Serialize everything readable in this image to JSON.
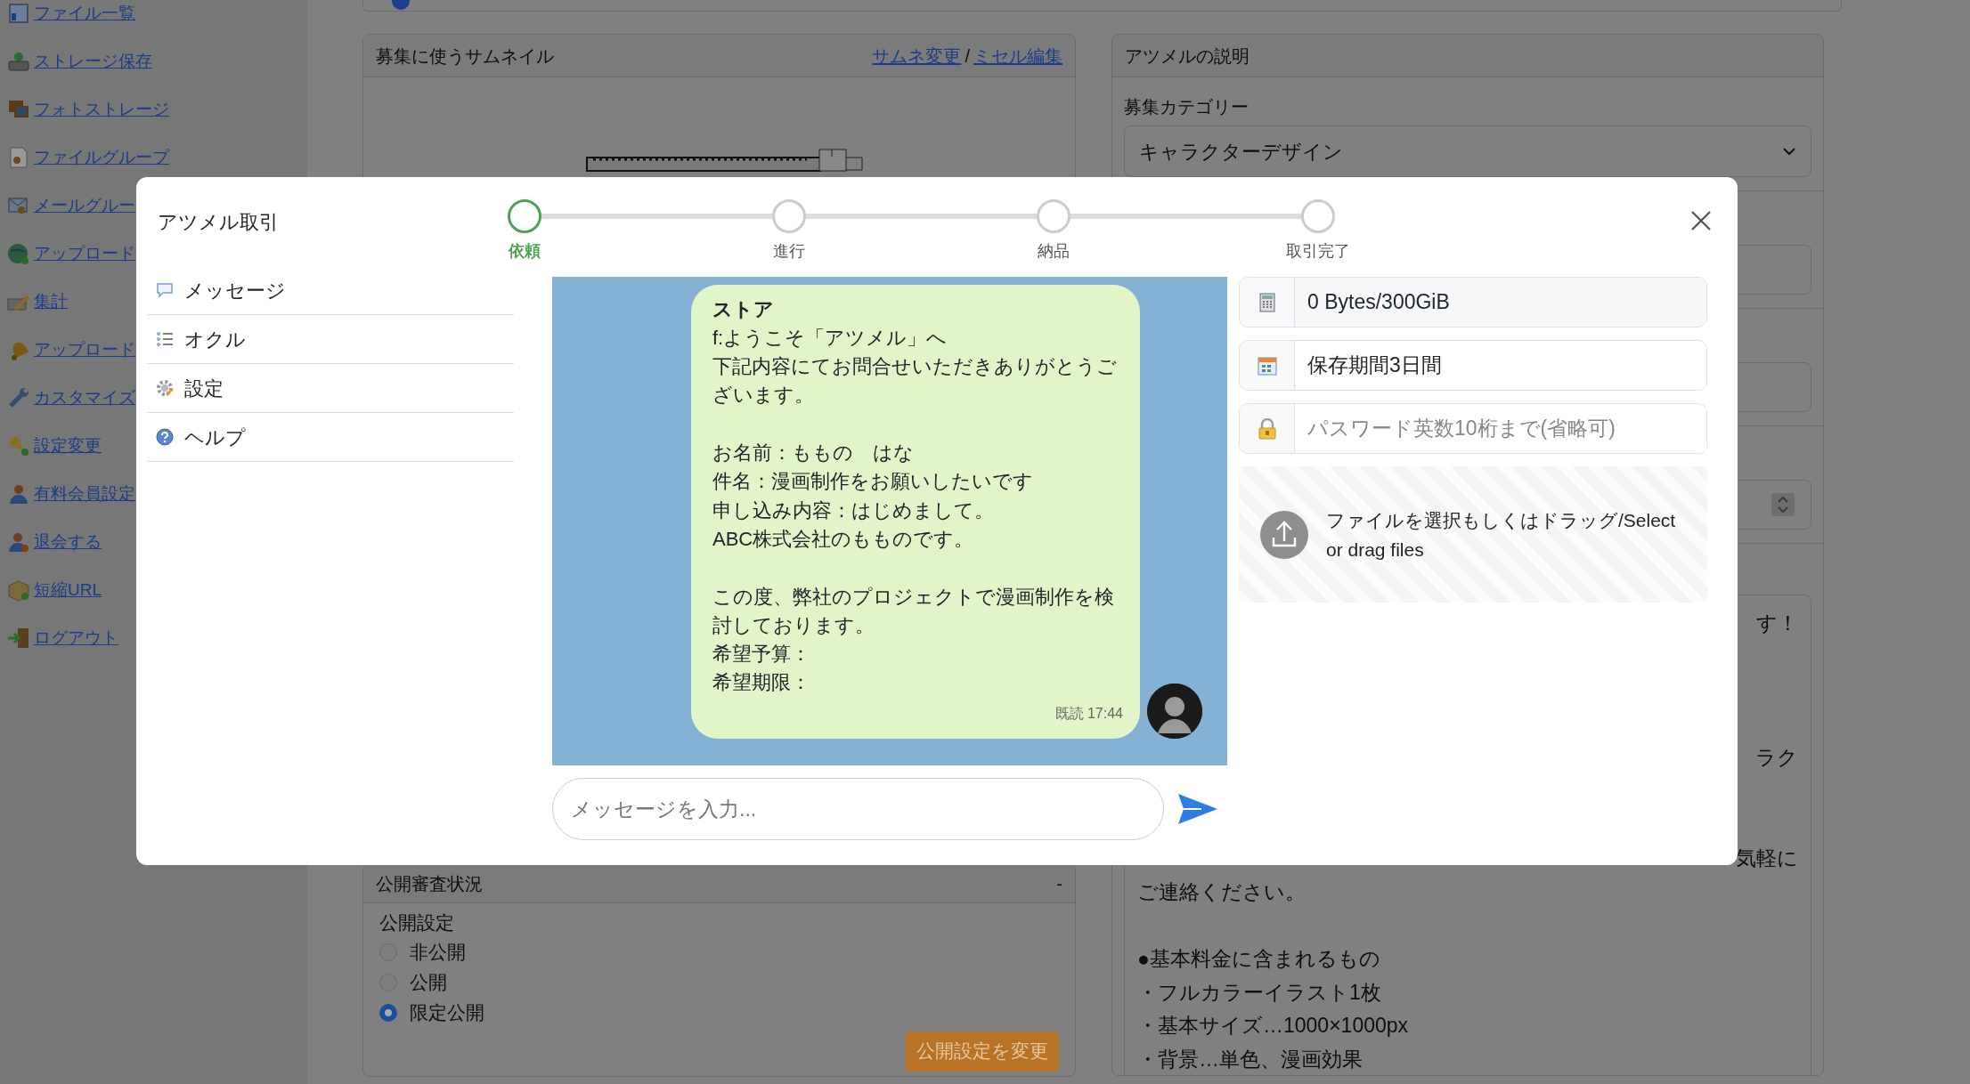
{
  "sidebar": {
    "links": [
      {
        "label": "ファイル一覧"
      },
      {
        "label": "ストレージ保存"
      },
      {
        "label": "フォトストレージ"
      },
      {
        "label": "ファイルグループ"
      },
      {
        "label": "メールグルー"
      },
      {
        "label": "アップロード"
      },
      {
        "label": "集計"
      },
      {
        "label": "アップロード"
      },
      {
        "label": "カスタマイズ"
      },
      {
        "label": "設定変更"
      },
      {
        "label": "有料会員設定"
      },
      {
        "label": "退会する"
      },
      {
        "label": "短縮URL"
      },
      {
        "label": "ログアウト"
      }
    ]
  },
  "thumbnail_card": {
    "title": "募集に使うサムネイル",
    "links": [
      "サムネ変更",
      "ミセル編集"
    ],
    "separator": "/"
  },
  "description_card": {
    "title": "アツメルの説明",
    "category_label": "募集カテゴリー",
    "category": "キャラクターデザイン",
    "fragments": [
      "す！",
      "ラク",
      "気軽に"
    ],
    "lines": [
      "ご連絡ください。",
      "●基本料金に含まれるもの",
      "・フルカラーイラスト1枚",
      "・基本サイズ…1000×1000px",
      "・背景…単色、漫画効果"
    ]
  },
  "publish_card": {
    "title": "公開審査状況",
    "toggle": "-",
    "label": "公開設定",
    "options": [
      {
        "label": "非公開",
        "selected": false
      },
      {
        "label": "公開",
        "selected": false
      },
      {
        "label": "限定公開",
        "selected": true
      }
    ],
    "button": "公開設定を変更"
  },
  "modal": {
    "title": "アツメル取引",
    "steps": [
      {
        "label": "依頼",
        "selected": true
      },
      {
        "label": "進行",
        "selected": false
      },
      {
        "label": "納品",
        "selected": false
      },
      {
        "label": "取引完了",
        "selected": false
      }
    ],
    "menu": [
      {
        "label": "メッセージ"
      },
      {
        "label": "オクル"
      },
      {
        "label": "設定"
      },
      {
        "label": "ヘルプ"
      }
    ],
    "message": {
      "sender": "ストア",
      "paragraphs": [
        [
          "f:ようこそ「アツメル」へ",
          "下記内容にてお問合せいただきありがとうございます。"
        ],
        [
          "お名前：ももの　はな",
          "件名：漫画制作をお願いしたいです",
          "申し込み内容：はじめまして。",
          "ABC株式会社のもものです。"
        ],
        [
          "この度、弊社のプロジェクトで漫画制作を検討しております。",
          "希望予算：",
          "希望期限："
        ]
      ],
      "status": "既読 17:44"
    },
    "input": {
      "placeholder": "メッセージを入力..."
    },
    "storage": "0 Bytes/300GiB",
    "retention": "保存期間3日間",
    "password": {
      "placeholder": "パスワード英数10桁まで(省略可)"
    },
    "dropzone": "ファイルを選択もしくはドラッグ/Select or drag files"
  }
}
